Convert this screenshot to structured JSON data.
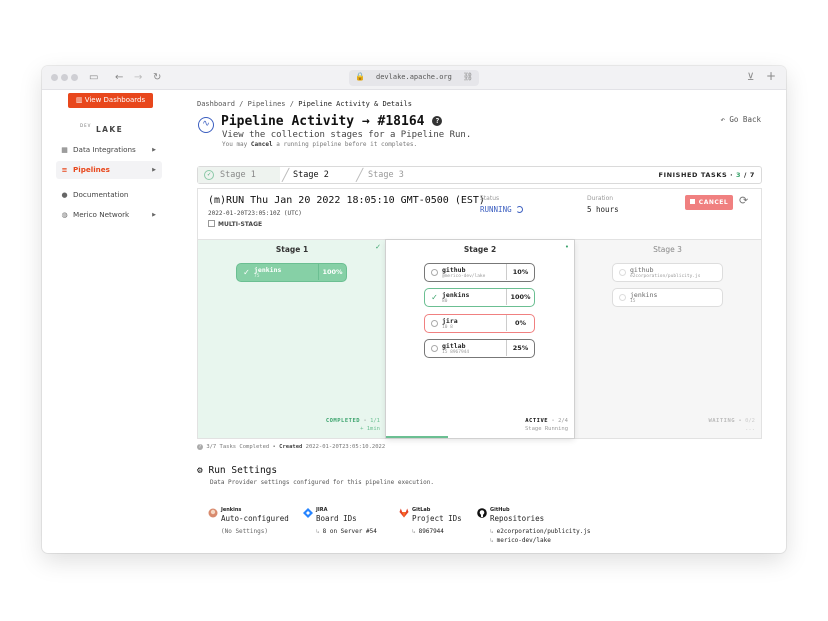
{
  "browser": {
    "url": "devlake.apache.org"
  },
  "sidebar": {
    "view_dashboards": "View Dashboards",
    "logo_top": "DEV",
    "logo_main": "LAKE",
    "items": [
      {
        "label": "Data Integrations"
      },
      {
        "label": "Pipelines"
      },
      {
        "label": "Documentation"
      },
      {
        "label": "Merico Network"
      }
    ]
  },
  "breadcrumb": {
    "items": [
      "Dashboard",
      "Pipelines",
      "Pipeline Activity & Details"
    ],
    "separator": "/"
  },
  "header": {
    "go_back": "Go Back",
    "title": "Pipeline Activity → #18164",
    "subtitle": "View the collection stages for a Pipeline Run.",
    "hint_prefix": "You may",
    "hint_bold": "Cancel",
    "hint_suffix": "a running pipeline before it completes."
  },
  "tabs": {
    "items": [
      "Stage 1",
      "Stage 2",
      "Stage 3"
    ],
    "finished_label": "FINISHED TASKS",
    "finished_done": "3",
    "finished_total": "7"
  },
  "run": {
    "title": "(m)RUN Thu Jan 20 2022 18:05:10 GMT-0500 (EST)",
    "timestamp": "2022-01-20T23:05:10Z (UTC)",
    "multi_stage": "MULTI-STAGE",
    "status_label": "Status",
    "status_value": "RUNNING",
    "duration_label": "Duration",
    "duration_value": "5 hours",
    "cancel": "CANCEL"
  },
  "stages": [
    {
      "name": "Stage 1",
      "tasks": [
        {
          "name": "jenkins",
          "sub": "75",
          "progress": "100%"
        }
      ],
      "footer_status": "COMPLETED",
      "footer_count": "1/1",
      "footer_time": "+ 1min"
    },
    {
      "name": "Stage 2",
      "tasks": [
        {
          "name": "github",
          "sub": "@merico-dev/lake",
          "progress": "10%"
        },
        {
          "name": "jenkins",
          "sub": "80",
          "progress": "100%"
        },
        {
          "name": "jira",
          "sub": "10 8",
          "progress": "0%"
        },
        {
          "name": "gitlab",
          "sub": "15 8967944",
          "progress": "25%"
        }
      ],
      "footer_status": "ACTIVE",
      "footer_count": "2/4",
      "footer_sub": "Stage Running"
    },
    {
      "name": "Stage 3",
      "tasks": [
        {
          "name": "github",
          "sub": "e2corporation/publicity.js"
        },
        {
          "name": "jenkins",
          "sub": "15"
        }
      ],
      "footer_status": "WAITING",
      "footer_count": "0/2",
      "footer_sub": "..."
    }
  ],
  "summary": {
    "tasks_completed": "3/7 Tasks Completed",
    "created_label": "Created",
    "created_value": "2022-01-20T23:05:10.2022"
  },
  "run_settings": {
    "title": "Run Settings",
    "subtitle": "Data Provider settings configured for this pipeline execution.",
    "providers": [
      {
        "name": "Jenkins",
        "title": "Auto-configured",
        "details": [
          "(No Settings)"
        ]
      },
      {
        "name": "JIRA",
        "title": "Board IDs",
        "details": [
          "8 on Server #54"
        ]
      },
      {
        "name": "GitLab",
        "title": "Project IDs",
        "details": [
          "8967944"
        ]
      },
      {
        "name": "GitHub",
        "title": "Repositories",
        "details": [
          "e2corporation/publicity.js",
          "merico-dev/lake"
        ]
      }
    ]
  },
  "colors": {
    "brand": "#e8471c",
    "accent_blue": "#3c5fc0",
    "success": "#3aa36c",
    "error": "#f08080"
  }
}
